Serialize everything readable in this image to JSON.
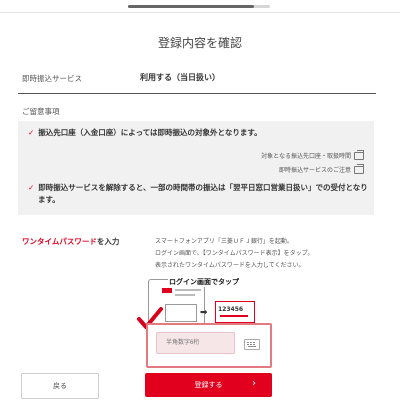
{
  "progress": {
    "fraction": 0.89
  },
  "page_title": "登録内容を確認",
  "service": {
    "label": "即時振込サービス",
    "value": "利用する（当日扱い）"
  },
  "notes": {
    "title": "ご留意事項",
    "item1": "振込先口座（入金口座）によっては即時振込の対象外となります。",
    "link1": "対象となる振込先口座・取扱時間",
    "link2": "即時振込サービスのご注意",
    "item2_line1": "即時振込サービスを解除すると、一部の時間帯の振込は「翌平日窓口営業日扱い」での受付となり",
    "item2_line2": "ます。"
  },
  "otp": {
    "label_red": "ワンタイムパスワード",
    "label_rest": "を入力",
    "instructions": [
      "スマートフォンアプリ「三菱ＵＦＪ銀行」を起動。",
      "ログイン画面で、【ワンタイムパスワード表示】をタップ。",
      "表示されたワンタイムパスワードを入力してください。"
    ],
    "illustration_callout": "ログイン画面でタップ",
    "illustration_code": "123456",
    "input_placeholder": "半角数字6桁",
    "colors": {
      "accent": "#e1001e",
      "frame": "#e27a7f"
    }
  },
  "buttons": {
    "back": "戻る",
    "submit": "登録する",
    "submit_icon": "chevron-right-icon"
  },
  "icons": [
    "external-link-icon",
    "checkmark-icon",
    "keyboard-icon",
    "phone-icon"
  ]
}
